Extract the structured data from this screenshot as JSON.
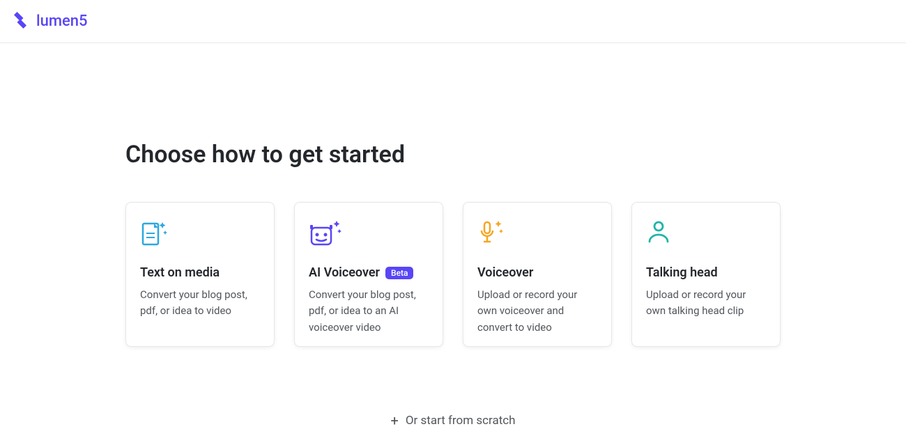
{
  "brand": {
    "name": "lumen5"
  },
  "page": {
    "heading": "Choose how to get started"
  },
  "cards": [
    {
      "title": "Text on media",
      "badge": null,
      "desc": "Convert your blog post, pdf, or idea to video"
    },
    {
      "title": "AI Voiceover",
      "badge": "Beta",
      "desc": "Convert your blog post, pdf, or idea to an AI voiceover video"
    },
    {
      "title": "Voiceover",
      "badge": null,
      "desc": "Upload or record your own voiceover and convert to video"
    },
    {
      "title": "Talking head",
      "badge": null,
      "desc": "Upload or record your own talking head clip"
    }
  ],
  "scratch": {
    "label": "Or start from scratch"
  }
}
